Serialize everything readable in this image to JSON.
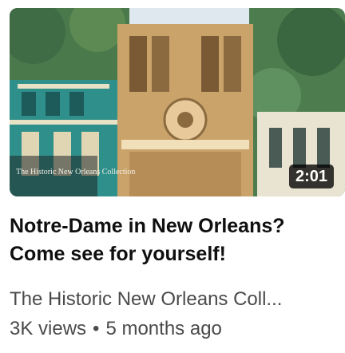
{
  "video": {
    "duration": "2:01",
    "title_line1": "Notre-Dame in New Orleans?",
    "title_line2": "Come see for yourself!",
    "channel": "The Historic New Orleans Coll...",
    "views": "3K views",
    "separator": "•",
    "age": "5 months ago"
  },
  "thumbnail": {
    "logo_text": "The Historic New Orleans Collection",
    "colors": {
      "facade": "#c9a36a",
      "sky": "#dfe8ef",
      "foliage": "#3f6b45",
      "balcony_house": "#2f8f8a"
    }
  }
}
